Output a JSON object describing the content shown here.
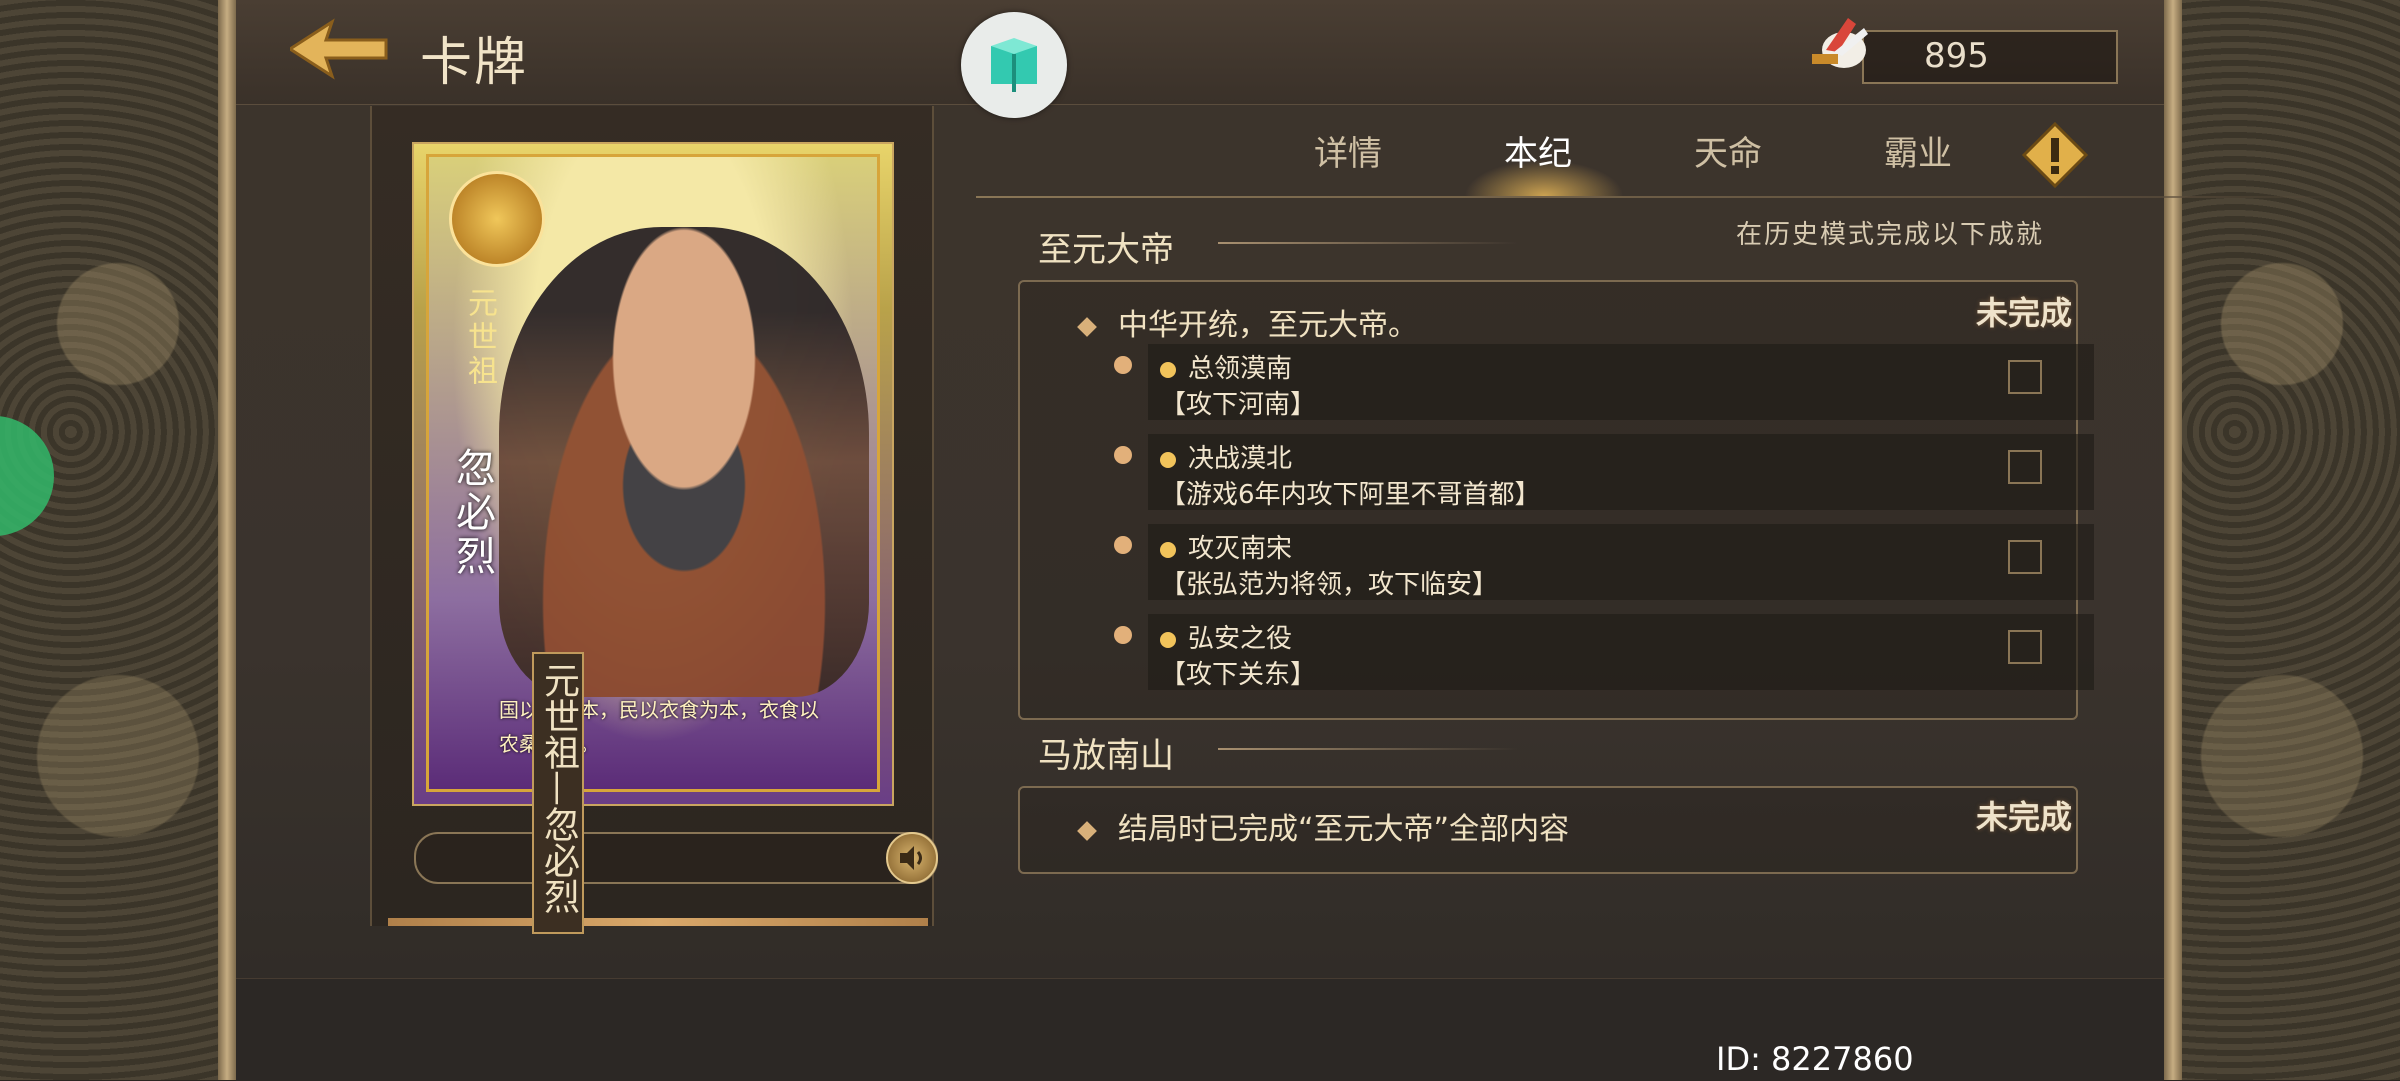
{
  "header": {
    "title": "卡牌",
    "currency_value": "895"
  },
  "card": {
    "vertical_title": "元世祖",
    "vertical_name": "忽必烈",
    "quote": "国以民为本，民以衣食为本，衣食以农桑为本。",
    "name_plaque": "元世祖—忽必烈"
  },
  "tabs": [
    {
      "label": "详情",
      "active": false
    },
    {
      "label": "本纪",
      "active": true
    },
    {
      "label": "天命",
      "active": false
    },
    {
      "label": "霸业",
      "active": false
    }
  ],
  "sections": [
    {
      "title": "至元大帝",
      "note": "在历史模式完成以下成就",
      "headline": "中华开统，至元大帝。",
      "status": "未完成",
      "tasks": [
        {
          "name": "总领漠南",
          "desc": "【攻下河南】"
        },
        {
          "name": "决战漠北",
          "desc": "【游戏6年内攻下阿里不哥首都】"
        },
        {
          "name": "攻灭南宋",
          "desc": "【张弘范为将领，攻下临安】"
        },
        {
          "name": "弘安之役",
          "desc": "【攻下关东】"
        }
      ]
    },
    {
      "title": "马放南山",
      "headline": "结局时已完成“至元大帝”全部内容",
      "status": "未完成"
    }
  ],
  "footer": {
    "user_id": "ID: 8227860"
  },
  "colors": {
    "accent_gold": "#d8b07a",
    "panel_border": "#7c6a50",
    "active_tab": "#ffffff",
    "float_button": "#33b86a"
  },
  "icons": [
    "back-arrow-icon",
    "crystal-icon",
    "feather-token-icon",
    "alert-icon",
    "speaker-icon"
  ]
}
